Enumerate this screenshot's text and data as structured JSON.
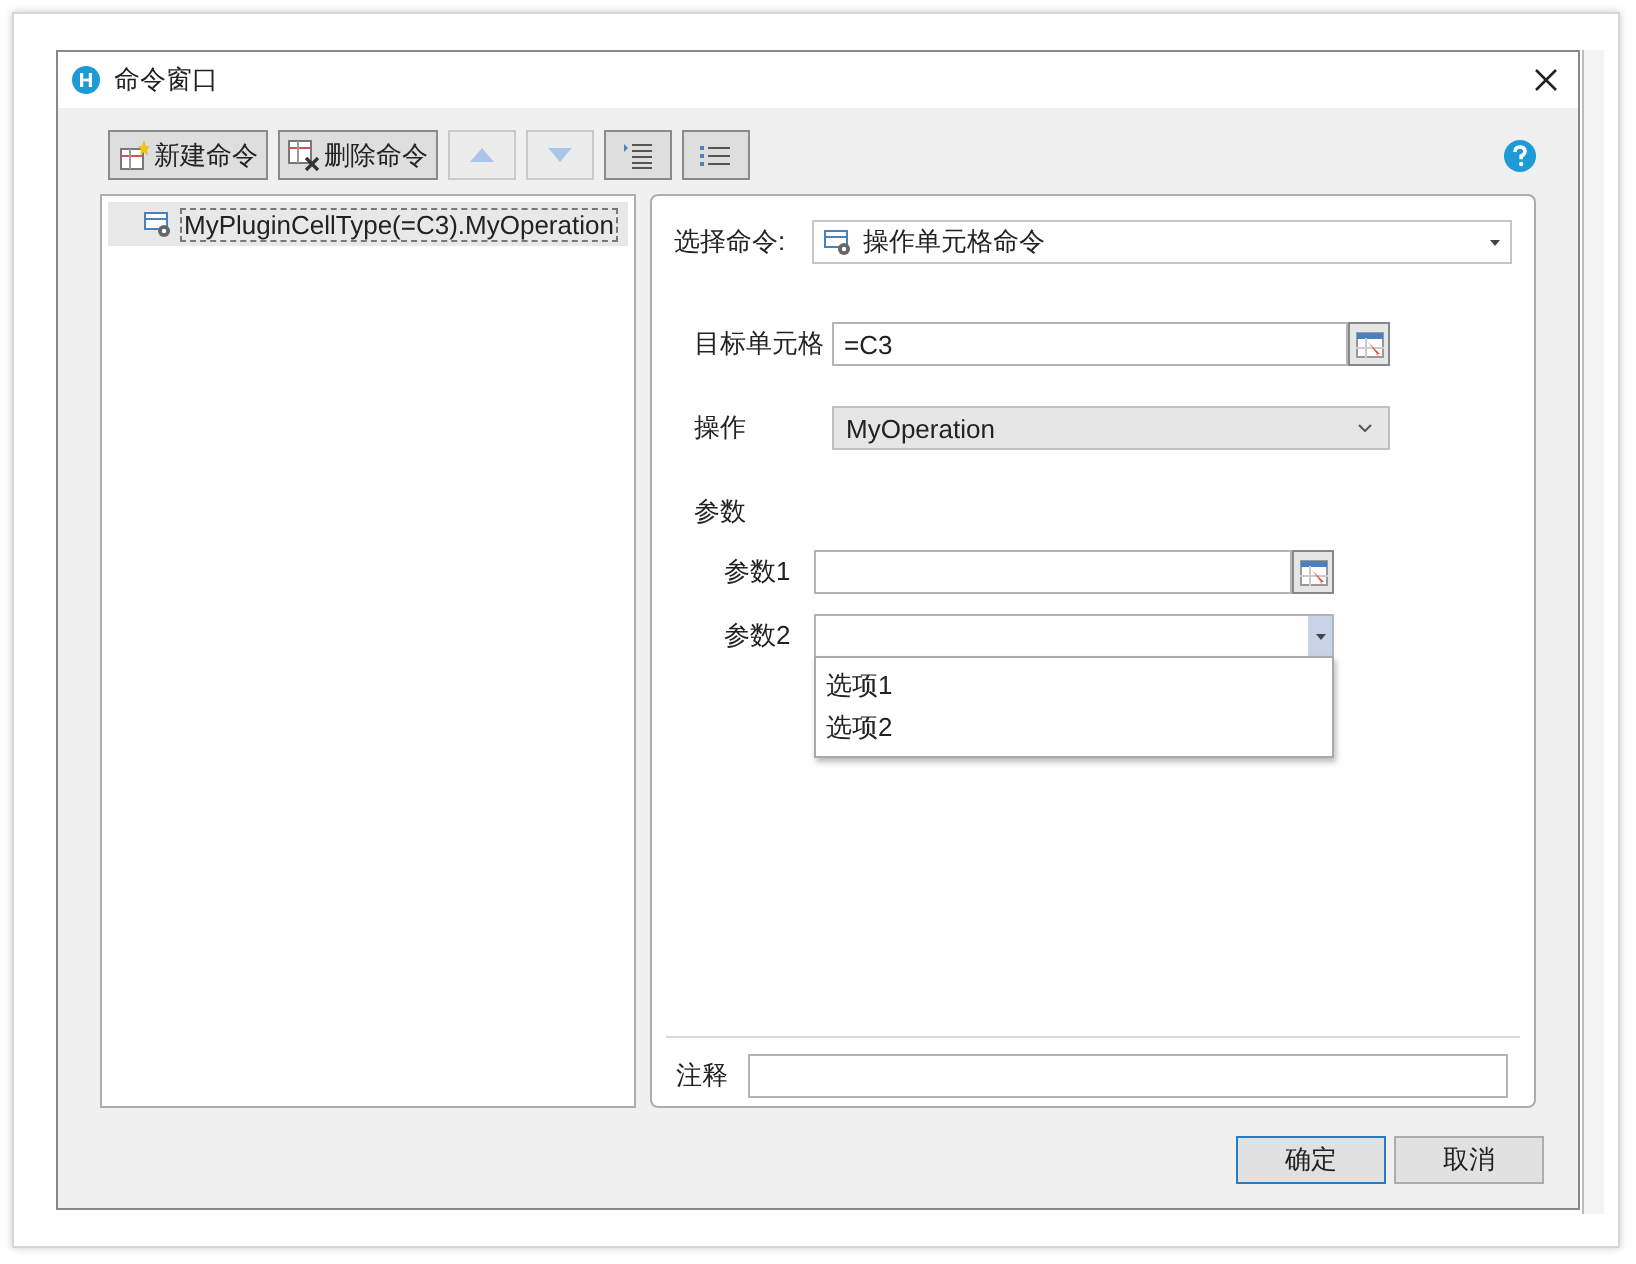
{
  "window": {
    "title": "命令窗口"
  },
  "toolbar": [
    {
      "kind": "new",
      "label": "新建命令",
      "disabled": false
    },
    {
      "kind": "delete",
      "label": "删除命令",
      "disabled": false
    },
    {
      "kind": "up",
      "disabled": true
    },
    {
      "kind": "down",
      "disabled": true
    },
    {
      "kind": "indent",
      "disabled": false
    },
    {
      "kind": "outdent",
      "disabled": false
    }
  ],
  "command_tree": [
    {
      "label": "MyPluginCellType(=C3).MyOperation",
      "selected": true
    }
  ],
  "select_command": {
    "label": "选择命令:",
    "value": "操作单元格命令"
  },
  "target_cell": {
    "label": "目标单元格",
    "value": "=C3"
  },
  "operation": {
    "label": "操作",
    "value": "MyOperation"
  },
  "parameters": {
    "label": "参数",
    "items": [
      {
        "kind": "cell",
        "label": "参数1"
      },
      {
        "kind": "dropdown",
        "label": "参数2",
        "expanded": true,
        "options": [
          "选项1",
          "选项2"
        ]
      }
    ]
  },
  "note": {
    "label": "注释"
  },
  "buttons": [
    {
      "label": "确定",
      "default": true
    },
    {
      "label": "取消",
      "default": false
    }
  ]
}
